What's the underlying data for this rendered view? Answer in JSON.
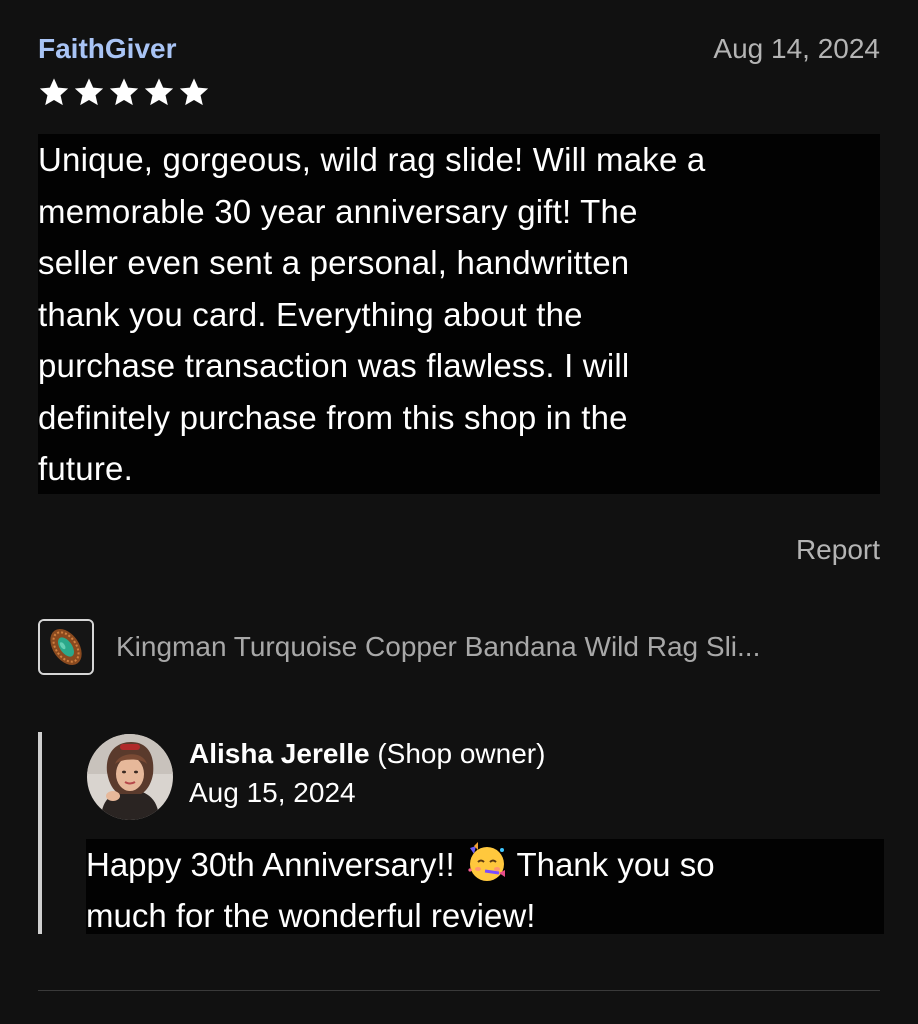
{
  "review": {
    "reviewer_name": "FaithGiver",
    "date": "Aug 14, 2024",
    "rating": 5,
    "text_line_1": "Unique, gorgeous, wild rag slide! Will make a",
    "text_line_2": "memorable 30 year anniversary gift! The",
    "text_line_3": "seller even sent a personal, handwritten",
    "text_line_4": "thank you card. Everything about the",
    "text_line_5": "purchase transaction was flawless. I will",
    "text_line_6": "definitely purchase from this shop in the",
    "text_line_7": "future.",
    "report_label": "Report"
  },
  "item": {
    "title": "Kingman Turquoise Copper Bandana Wild Rag Sli..."
  },
  "reply": {
    "owner_name": "Alisha Jerelle",
    "owner_role": "(Shop owner)",
    "date": "Aug 15, 2024",
    "text_part_1": "Happy 30th Anniversary!! ",
    "emoji": "partying-face",
    "text_part_2": " Thank you so",
    "text_line_2": "much for the wonderful review!"
  },
  "colors": {
    "background": "#111111",
    "reviewer_name": "#a9c4f5",
    "muted_text": "#b4b4b4",
    "text_highlight_bg": "#020202"
  }
}
